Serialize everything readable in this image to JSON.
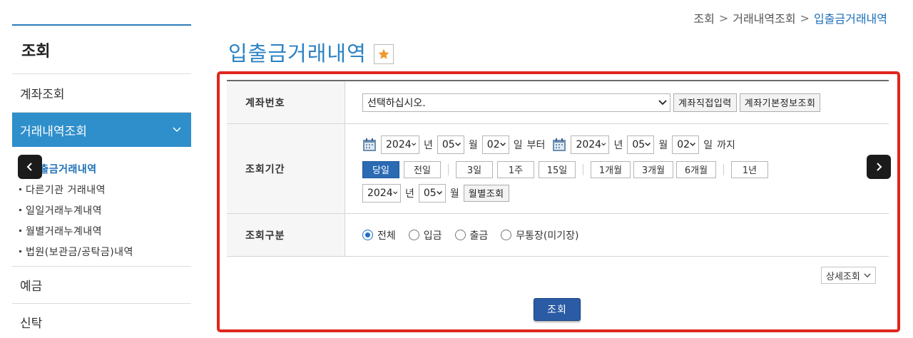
{
  "breadcrumb": {
    "items": [
      "조회",
      "거래내역조회"
    ],
    "current": "입출금거래내역",
    "separator": ">"
  },
  "sidebar": {
    "title": "조회",
    "items": [
      {
        "label": "계좌조회"
      },
      {
        "label": "거래내역조회",
        "active": true
      },
      {
        "label": "예금"
      },
      {
        "label": "신탁"
      }
    ],
    "sub_items": [
      {
        "label": "입출금거래내역",
        "current": true
      },
      {
        "label": "다른기관 거래내역"
      },
      {
        "label": "일일거래누계내역"
      },
      {
        "label": "월별거래누계내역"
      },
      {
        "label": "법원(보관금/공탁금)내역"
      }
    ]
  },
  "page": {
    "title": "입출금거래내역",
    "star_icon": "star-icon"
  },
  "form": {
    "account": {
      "label": "계좌번호",
      "select_value": "선택하십시오.",
      "direct_input_button": "계좌직접입력",
      "info_button": "계좌기본정보조회"
    },
    "period": {
      "label": "조회기간",
      "from": {
        "year": "2024",
        "month": "05",
        "day": "02"
      },
      "to": {
        "year": "2024",
        "month": "05",
        "day": "02"
      },
      "unit_year": "년",
      "unit_month": "월",
      "unit_day": "일",
      "from_suffix": "부터",
      "to_suffix": "까지",
      "quick_buttons": [
        "당일",
        "전일",
        "3일",
        "1주",
        "15일",
        "1개월",
        "3개월",
        "6개월",
        "1년"
      ],
      "quick_active": "당일",
      "monthly": {
        "year": "2024",
        "month": "05",
        "button": "월별조회"
      }
    },
    "type": {
      "label": "조회구분",
      "options": [
        "전체",
        "입금",
        "출금",
        "무통장(미기장)"
      ],
      "selected": "전체"
    },
    "detail_button": "상세조회",
    "submit_button": "조회"
  },
  "colors": {
    "accent": "#2b82c4",
    "sidebar_active": "#2f8fcb",
    "highlight_frame": "#e0261e",
    "primary_button": "#2a5ba4"
  }
}
